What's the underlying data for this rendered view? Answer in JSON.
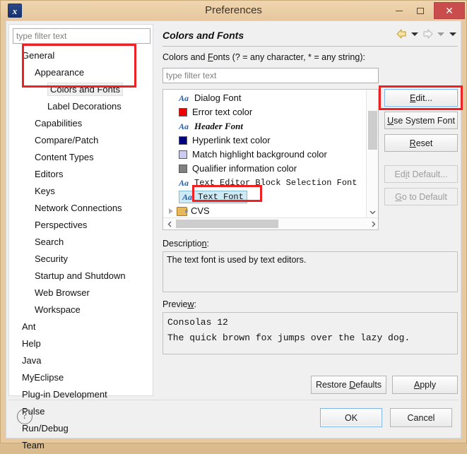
{
  "window": {
    "title": "Preferences",
    "app_icon": "eclipse-app-icon",
    "minimize_label": "Minimize",
    "maximize_label": "Maximize",
    "close_label": "Close"
  },
  "sidebar": {
    "filter_placeholder": "type filter text",
    "filter_value": "",
    "items": [
      {
        "label": "General",
        "level": 0,
        "selected": false
      },
      {
        "label": "Appearance",
        "level": 1,
        "selected": false
      },
      {
        "label": "Colors and Fonts",
        "level": 2,
        "selected": true
      },
      {
        "label": "Label Decorations",
        "level": 2,
        "selected": false
      },
      {
        "label": "Capabilities",
        "level": 1,
        "selected": false
      },
      {
        "label": "Compare/Patch",
        "level": 1,
        "selected": false
      },
      {
        "label": "Content Types",
        "level": 1,
        "selected": false
      },
      {
        "label": "Editors",
        "level": 1,
        "selected": false
      },
      {
        "label": "Keys",
        "level": 1,
        "selected": false
      },
      {
        "label": "Network Connections",
        "level": 1,
        "selected": false
      },
      {
        "label": "Perspectives",
        "level": 1,
        "selected": false
      },
      {
        "label": "Search",
        "level": 1,
        "selected": false
      },
      {
        "label": "Security",
        "level": 1,
        "selected": false
      },
      {
        "label": "Startup and Shutdown",
        "level": 1,
        "selected": false
      },
      {
        "label": "Web Browser",
        "level": 1,
        "selected": false
      },
      {
        "label": "Workspace",
        "level": 1,
        "selected": false
      },
      {
        "label": "Ant",
        "level": 0,
        "selected": false
      },
      {
        "label": "Help",
        "level": 0,
        "selected": false
      },
      {
        "label": "Java",
        "level": 0,
        "selected": false
      },
      {
        "label": "MyEclipse",
        "level": 0,
        "selected": false
      },
      {
        "label": "Plug-in Development",
        "level": 0,
        "selected": false
      },
      {
        "label": "Pulse",
        "level": 0,
        "selected": false
      },
      {
        "label": "Run/Debug",
        "level": 0,
        "selected": false
      },
      {
        "label": "Team",
        "level": 0,
        "selected": false
      }
    ]
  },
  "page": {
    "title": "Colors and Fonts",
    "nav": {
      "back_icon": "back-arrow-icon",
      "back_menu_icon": "chevron-down-icon",
      "forward_icon": "forward-arrow-icon",
      "forward_menu_icon": "chevron-down-icon",
      "view_menu_icon": "chevron-down-icon"
    },
    "filter_label_pre": "Colors and ",
    "filter_label_mnemonic": "F",
    "filter_label_post": "onts (? = any character, * = any string):",
    "filter_placeholder": "type filter text",
    "filter_value": "",
    "list": [
      {
        "label": "Dialog Font",
        "icon": "font-aa-icon",
        "style": "plain",
        "indent": 1,
        "selected": false
      },
      {
        "label": "Error text color",
        "icon": "color-swatch-icon",
        "color": "#ee0000",
        "style": "plain",
        "indent": 1,
        "selected": false
      },
      {
        "label": "Header Font",
        "icon": "font-aa-icon",
        "style": "serif-bold-italic",
        "indent": 1,
        "selected": false
      },
      {
        "label": "Hyperlink text color",
        "icon": "color-swatch-icon",
        "color": "#00007f",
        "style": "plain",
        "indent": 1,
        "selected": false
      },
      {
        "label": "Match highlight background color",
        "icon": "color-swatch-icon",
        "color": "#ccccf2",
        "style": "plain",
        "indent": 1,
        "selected": false
      },
      {
        "label": "Qualifier information color",
        "icon": "color-swatch-icon",
        "color": "#808080",
        "style": "plain",
        "indent": 1,
        "selected": false
      },
      {
        "label": "Text Editor Block Selection Font",
        "icon": "font-aa-icon",
        "style": "mono",
        "indent": 1,
        "selected": false
      },
      {
        "label": "Text Font",
        "icon": "font-aa-icon",
        "style": "mono",
        "indent": 1,
        "selected": true
      },
      {
        "label": "CVS",
        "icon": "folder-font-icon",
        "style": "plain",
        "indent": 0,
        "selected": false,
        "expandable": true
      }
    ],
    "scroll": {
      "up_icon": "chevron-up-icon",
      "down_icon": "chevron-down-icon",
      "left_icon": "chevron-left-icon",
      "right_icon": "chevron-right-icon"
    },
    "buttons": [
      {
        "label": "Edit...",
        "mnemonic": "E",
        "enabled": true,
        "highlighted": true
      },
      {
        "label": "Use System Font",
        "mnemonic": "U",
        "enabled": true,
        "highlighted": false
      },
      {
        "label": "Reset",
        "mnemonic": "R",
        "enabled": true,
        "highlighted": false
      },
      {
        "label": "Edit Default...",
        "mnemonic": "i",
        "enabled": false,
        "highlighted": false
      },
      {
        "label": "Go to Default",
        "mnemonic": "G",
        "enabled": false,
        "highlighted": false
      }
    ],
    "description": {
      "label_pre": "Descriptio",
      "label_mnemonic": "n",
      "label_post": ":",
      "text": "The text font is used by text editors."
    },
    "preview": {
      "label_pre": "Previe",
      "label_mnemonic": "w",
      "label_post": ":",
      "line1": "Consolas 12",
      "line2": "The quick brown fox jumps over the lazy dog."
    },
    "restore_defaults": {
      "label_pre": "Restore ",
      "label_mnemonic": "D",
      "label_post": "efaults"
    },
    "apply": {
      "label_pre": "",
      "label_mnemonic": "A",
      "label_post": "pply"
    }
  },
  "footer": {
    "help_icon": "help-question-icon",
    "ok_label": "OK",
    "cancel_label": "Cancel"
  },
  "annotations": {
    "highlight_color": "#ee2222",
    "boxes": [
      "sidebar-general-to-colors-and-fonts",
      "list-text-font-row",
      "edit-button"
    ]
  }
}
